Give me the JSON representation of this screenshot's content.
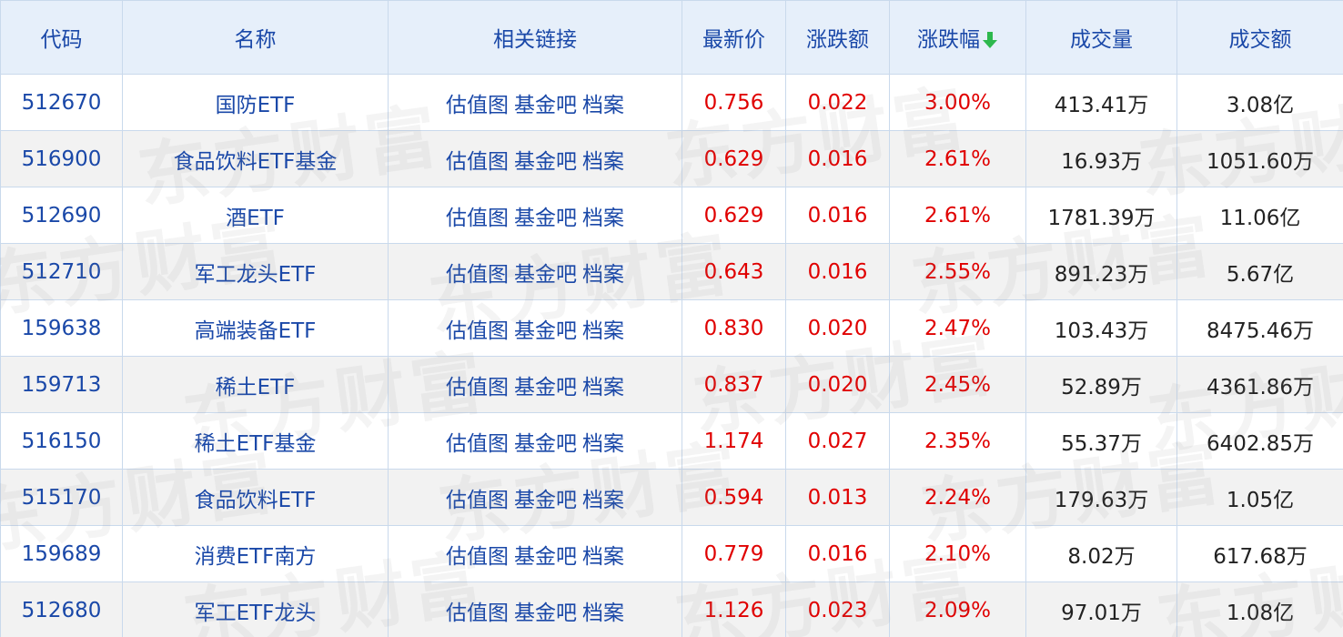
{
  "table": {
    "headers": [
      "代码",
      "名称",
      "相关链接",
      "最新价",
      "涨跌额",
      "涨跌幅",
      "成交量",
      "成交额"
    ],
    "sort_column": "涨跌幅",
    "sort_direction": "desc",
    "sort_icon": "arrow-down-icon",
    "link_labels": [
      "估值图",
      "基金吧",
      "档案"
    ],
    "rows": [
      {
        "code": "512670",
        "name": "国防ETF",
        "price": "0.756",
        "change": "0.022",
        "pct": "3.00%",
        "volume": "413.41万",
        "amount": "3.08亿"
      },
      {
        "code": "516900",
        "name": "食品饮料ETF基金",
        "price": "0.629",
        "change": "0.016",
        "pct": "2.61%",
        "volume": "16.93万",
        "amount": "1051.60万"
      },
      {
        "code": "512690",
        "name": "酒ETF",
        "price": "0.629",
        "change": "0.016",
        "pct": "2.61%",
        "volume": "1781.39万",
        "amount": "11.06亿"
      },
      {
        "code": "512710",
        "name": "军工龙头ETF",
        "price": "0.643",
        "change": "0.016",
        "pct": "2.55%",
        "volume": "891.23万",
        "amount": "5.67亿"
      },
      {
        "code": "159638",
        "name": "高端装备ETF",
        "price": "0.830",
        "change": "0.020",
        "pct": "2.47%",
        "volume": "103.43万",
        "amount": "8475.46万"
      },
      {
        "code": "159713",
        "name": "稀土ETF",
        "price": "0.837",
        "change": "0.020",
        "pct": "2.45%",
        "volume": "52.89万",
        "amount": "4361.86万"
      },
      {
        "code": "516150",
        "name": "稀土ETF基金",
        "price": "1.174",
        "change": "0.027",
        "pct": "2.35%",
        "volume": "55.37万",
        "amount": "6402.85万"
      },
      {
        "code": "515170",
        "name": "食品饮料ETF",
        "price": "0.594",
        "change": "0.013",
        "pct": "2.24%",
        "volume": "179.63万",
        "amount": "1.05亿"
      },
      {
        "code": "159689",
        "name": "消费ETF南方",
        "price": "0.779",
        "change": "0.016",
        "pct": "2.10%",
        "volume": "8.02万",
        "amount": "617.68万"
      },
      {
        "code": "512680",
        "name": "军工ETF龙头",
        "price": "1.126",
        "change": "0.023",
        "pct": "2.09%",
        "volume": "97.01万",
        "amount": "1.08亿"
      }
    ]
  },
  "colors": {
    "header_bg": "#e6effa",
    "header_text": "#1a48a8",
    "link_blue": "#1a48a8",
    "up_red": "#e00000",
    "sort_arrow_green": "#2db84d",
    "border": "#c9d9ec",
    "stripe": "#eeeeee"
  },
  "watermark": "东方财富"
}
